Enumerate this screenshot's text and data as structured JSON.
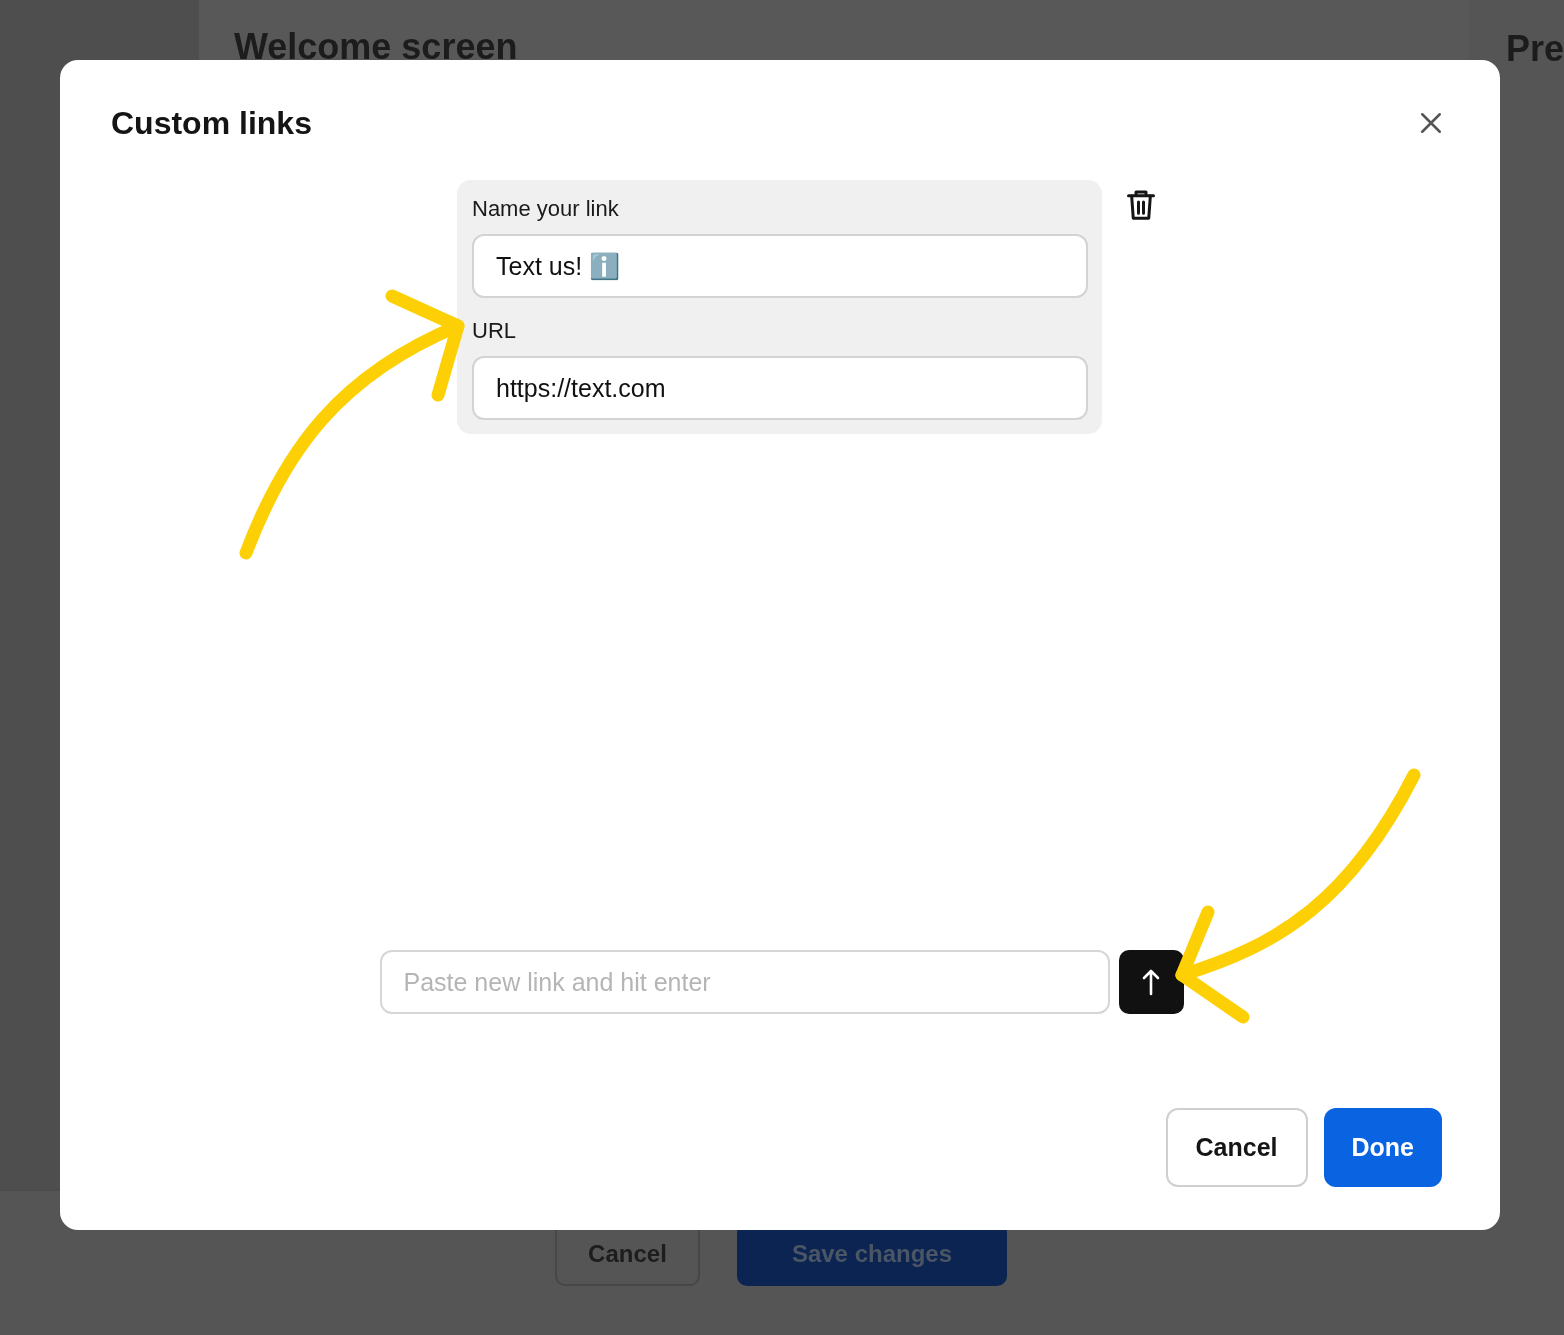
{
  "background": {
    "heading": "Welcome screen",
    "side_heading": "Pre",
    "buttons": [
      {
        "label": "Cancel",
        "kind": "secondary"
      },
      {
        "label": "Save changes",
        "kind": "primary"
      }
    ]
  },
  "modal": {
    "title": "Custom links",
    "link_fields": [
      {
        "label": "Name your link",
        "value": "Text us! ℹ️"
      },
      {
        "label": "URL",
        "value": "https://text.com"
      }
    ],
    "new_link": {
      "placeholder": "Paste new link and hit enter"
    },
    "buttons": [
      {
        "label": "Cancel",
        "kind": "secondary"
      },
      {
        "label": "Done",
        "kind": "primary"
      }
    ]
  }
}
